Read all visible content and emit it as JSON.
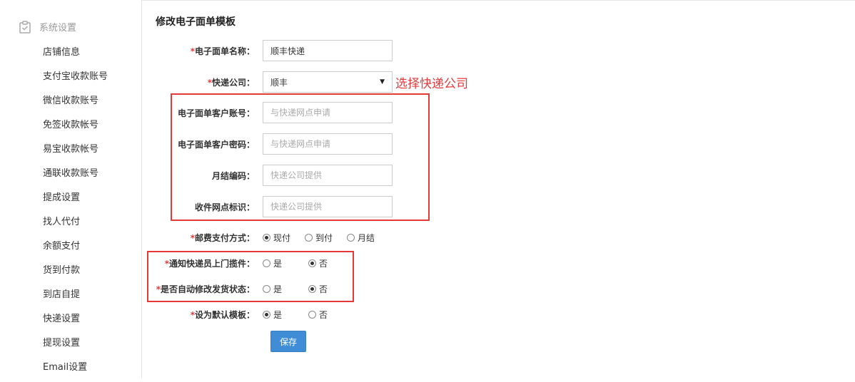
{
  "sidebar": {
    "section_title": "系统设置",
    "items": [
      {
        "label": "店铺信息"
      },
      {
        "label": "支付宝收款账号"
      },
      {
        "label": "微信收款账号"
      },
      {
        "label": "免签收款帐号"
      },
      {
        "label": "易宝收款帐号"
      },
      {
        "label": "通联收款账号"
      },
      {
        "label": "提成设置"
      },
      {
        "label": "找人代付"
      },
      {
        "label": "余额支付"
      },
      {
        "label": "货到付款"
      },
      {
        "label": "到店自提"
      },
      {
        "label": "快递设置"
      },
      {
        "label": "提现设置"
      },
      {
        "label": "Email设置"
      }
    ]
  },
  "form": {
    "title": "修改电子面单模板",
    "required_mark": "*",
    "name": {
      "label": "电子面单名称：",
      "value": "顺丰快递"
    },
    "company": {
      "label": "快递公司：",
      "value": "顺丰",
      "hint": "选择快递公司"
    },
    "account": {
      "label": "电子面单客户账号：",
      "placeholder": "与快递网点申请"
    },
    "password": {
      "label": "电子面单客户密码：",
      "placeholder": "与快递网点申请"
    },
    "monthly_code": {
      "label": "月结编码：",
      "placeholder": "快递公司提供"
    },
    "site_id": {
      "label": "收件网点标识：",
      "placeholder": "快递公司提供"
    },
    "postage": {
      "label": "邮费支付方式：",
      "options": [
        "现付",
        "到付",
        "月结"
      ],
      "selected": "现付"
    },
    "notify_courier": {
      "label": "通知快递员上门揽件：",
      "options": [
        "是",
        "否"
      ],
      "selected": "否"
    },
    "auto_update": {
      "label": "是否自动修改发货状态：",
      "options": [
        "是",
        "否"
      ],
      "selected": "否"
    },
    "default_tpl": {
      "label": "设为默认模板：",
      "options": [
        "是",
        "否"
      ],
      "selected": "是"
    },
    "save_label": "保存"
  }
}
